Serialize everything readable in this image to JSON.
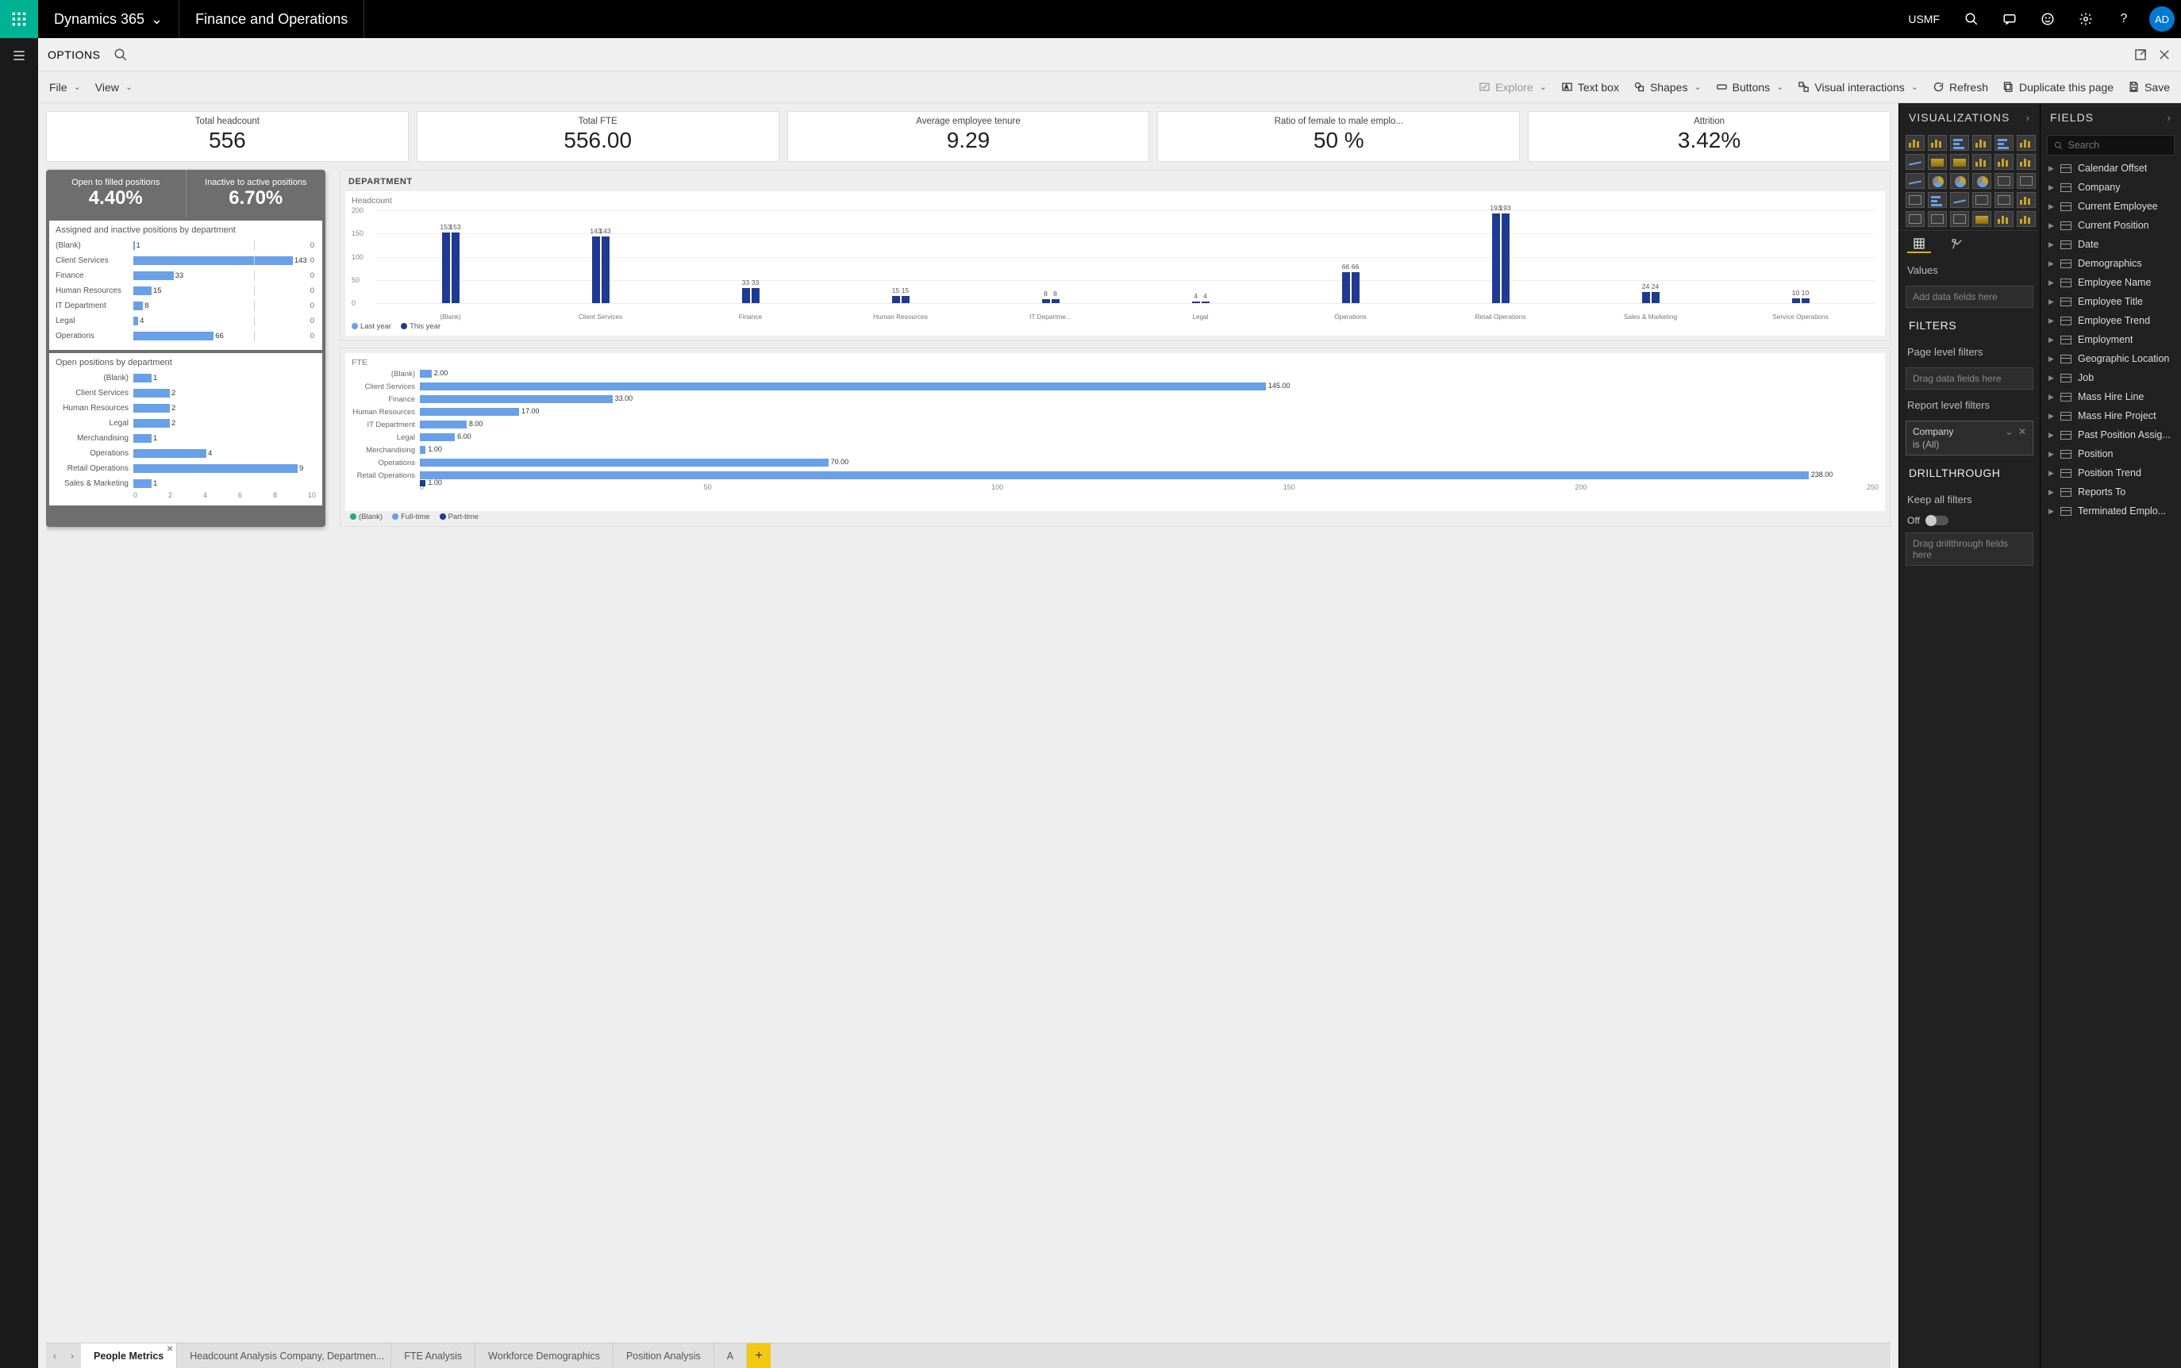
{
  "topbar": {
    "brand": "Dynamics 365",
    "module": "Finance and Operations",
    "entity": "USMF",
    "avatar": "AD"
  },
  "optionsbar": {
    "label": "OPTIONS"
  },
  "pbitoolbar": {
    "file": "File",
    "view": "View",
    "explore": "Explore",
    "textbox": "Text box",
    "shapes": "Shapes",
    "buttons": "Buttons",
    "visual_interactions": "Visual interactions",
    "refresh": "Refresh",
    "duplicate": "Duplicate this page",
    "save": "Save"
  },
  "kpis": [
    {
      "title": "Total headcount",
      "value": "556"
    },
    {
      "title": "Total FTE",
      "value": "556.00"
    },
    {
      "title": "Average employee tenure",
      "value": "9.29"
    },
    {
      "title": "Ratio of female to male emplo...",
      "value": "50 %"
    },
    {
      "title": "Attrition",
      "value": "3.42%"
    }
  ],
  "ratios": {
    "open_filled": {
      "title": "Open to filled positions",
      "value": "4.40%"
    },
    "inactive_active": {
      "title": "Inactive to active positions",
      "value": "6.70%"
    }
  },
  "assigned_title": "Assigned and inactive positions by department",
  "open_title": "Open positions by department",
  "dept_panel_title": "DEPARTMENT",
  "headcount_sub": "Headcount",
  "fte_sub": "FTE",
  "legend_last": "Last year",
  "legend_this": "This year",
  "fte_legend": [
    "(Blank)",
    "Full-time",
    "Part-time"
  ],
  "viz_panel": {
    "title": "VISUALIZATIONS",
    "values_label": "Values",
    "values_well": "Add data fields here"
  },
  "filters_panel": {
    "title": "FILTERS",
    "page_label": "Page level filters",
    "page_well": "Drag data fields here",
    "report_label": "Report level filters",
    "company_name": "Company",
    "company_cond": "is (All)"
  },
  "drill_panel": {
    "title": "DRILLTHROUGH",
    "keep_label": "Keep all filters",
    "off_label": "Off",
    "well": "Drag drillthrough fields here"
  },
  "fields_panel": {
    "title": "FIELDS",
    "search_placeholder": "Search",
    "tables": [
      "Calendar Offset",
      "Company",
      "Current Employee",
      "Current Position",
      "Date",
      "Demographics",
      "Employee Name",
      "Employee Title",
      "Employee Trend",
      "Employment",
      "Geographic Location",
      "Job",
      "Mass Hire Line",
      "Mass Hire Project",
      "Past Position Assig...",
      "Position",
      "Position Trend",
      "Reports To",
      "Terminated Emplo..."
    ]
  },
  "tabs": [
    "People Metrics",
    "Headcount Analysis Company, Departmen...",
    "FTE Analysis",
    "Workforce Demographics",
    "Position Analysis",
    "A"
  ],
  "chart_data": {
    "assigned_inactive": {
      "type": "bar",
      "orientation": "horizontal",
      "categories": [
        "(Blank)",
        "Client Services",
        "Finance",
        "Human Resources",
        "IT Department",
        "Legal",
        "Operations"
      ],
      "series": [
        {
          "name": "Assigned",
          "values": [
            1,
            143,
            33,
            15,
            8,
            4,
            66
          ]
        },
        {
          "name": "Inactive",
          "values": [
            0,
            0,
            0,
            0,
            0,
            0,
            0
          ]
        }
      ],
      "max": 150
    },
    "open_positions": {
      "type": "bar",
      "orientation": "horizontal",
      "categories": [
        "(Blank)",
        "Client Services",
        "Human Resources",
        "Legal",
        "Merchandising",
        "Operations",
        "Retail Operations",
        "Sales & Marketing"
      ],
      "values": [
        1,
        2,
        2,
        2,
        1,
        4,
        9,
        1
      ],
      "xticks": [
        0,
        2,
        4,
        6,
        8,
        10
      ],
      "xlim": [
        0,
        10
      ]
    },
    "headcount_dept": {
      "type": "bar",
      "categories": [
        "(Blank)",
        "Client Services",
        "Finance",
        "Human Resources",
        "IT Departme...",
        "Legal",
        "Operations",
        "Retail Operations",
        "Sales & Marketing",
        "Service Operations"
      ],
      "series": [
        {
          "name": "Last year",
          "values": [
            153,
            143,
            33,
            15,
            8,
            4,
            66,
            193,
            24,
            10
          ]
        },
        {
          "name": "This year",
          "values": [
            153,
            143,
            33,
            15,
            8,
            4,
            66,
            193,
            24,
            10
          ]
        }
      ],
      "yticks": [
        0,
        50,
        100,
        150,
        200
      ],
      "ylim": [
        0,
        200
      ]
    },
    "fte_dept": {
      "type": "bar",
      "orientation": "horizontal",
      "categories": [
        "(Blank)",
        "Client Services",
        "Finance",
        "Human Resources",
        "IT Department",
        "Legal",
        "Merchandising",
        "Operations",
        "Retail Operations"
      ],
      "values": [
        2.0,
        145.0,
        33.0,
        17.0,
        8.0,
        6.0,
        1.0,
        70.0,
        238.0
      ],
      "secondary_values": [
        null,
        null,
        null,
        null,
        null,
        null,
        null,
        null,
        1.0
      ],
      "xticks": [
        0,
        50,
        100,
        150,
        200,
        250
      ],
      "xlim": [
        0,
        250
      ]
    }
  }
}
